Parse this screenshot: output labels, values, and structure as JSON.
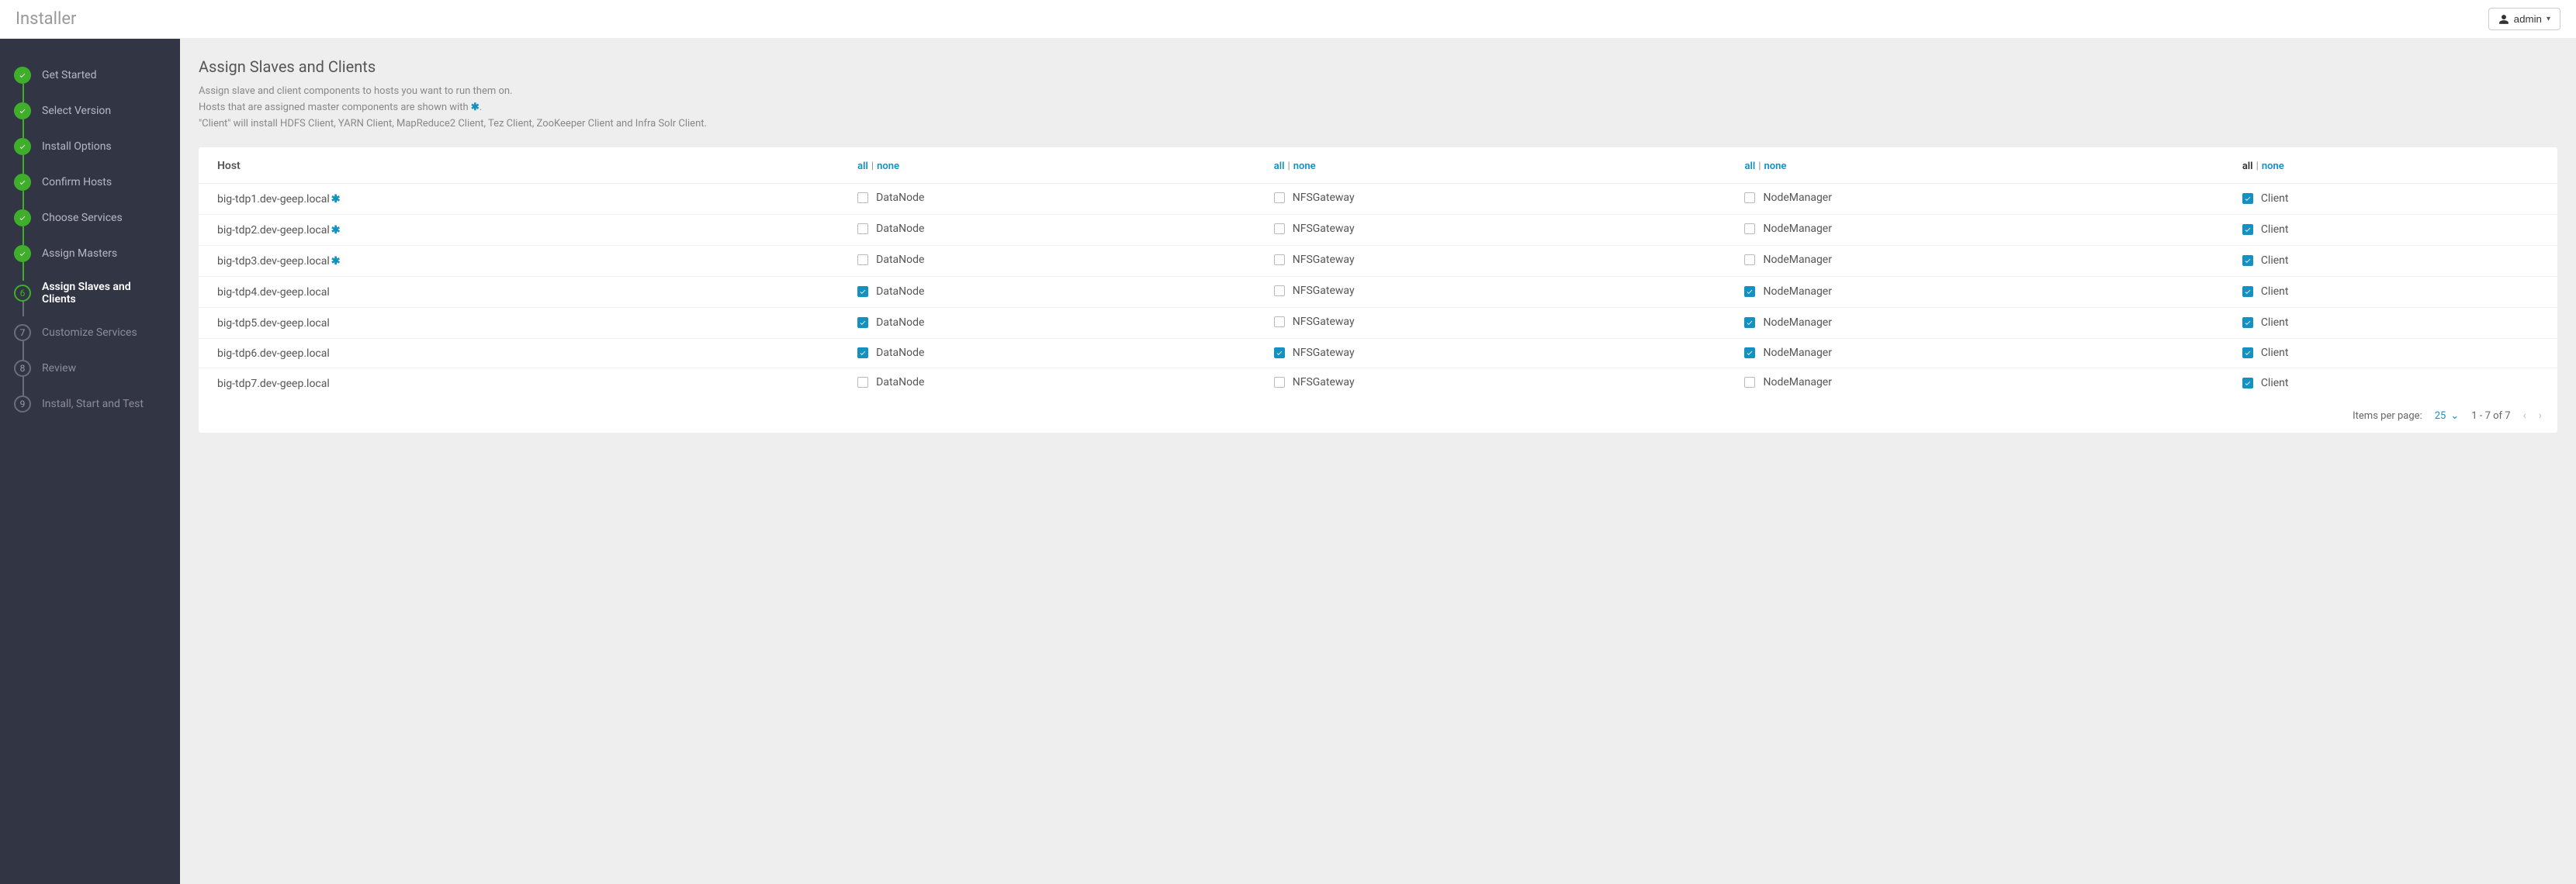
{
  "brand": "Installer",
  "user": {
    "name": "admin"
  },
  "sidebar": {
    "steps": [
      {
        "label": "Get Started",
        "state": "done"
      },
      {
        "label": "Select Version",
        "state": "done"
      },
      {
        "label": "Install Options",
        "state": "done"
      },
      {
        "label": "Confirm Hosts",
        "state": "done"
      },
      {
        "label": "Choose Services",
        "state": "done"
      },
      {
        "label": "Assign Masters",
        "state": "done"
      },
      {
        "label": "Assign Slaves and Clients",
        "state": "current",
        "num": "6"
      },
      {
        "label": "Customize Services",
        "state": "pending",
        "num": "7"
      },
      {
        "label": "Review",
        "state": "pending",
        "num": "8"
      },
      {
        "label": "Install, Start and Test",
        "state": "pending",
        "num": "9"
      }
    ]
  },
  "page": {
    "title": "Assign Slaves and Clients",
    "desc1": "Assign slave and client components to hosts you want to run them on.",
    "desc2a": "Hosts that are assigned master components are shown with ",
    "desc2b": ".",
    "desc3": "\"Client\" will install HDFS Client, YARN Client, MapReduce2 Client, Tez Client, ZooKeeper Client and Infra Solr Client."
  },
  "table": {
    "hostHeader": "Host",
    "allLabel": "all",
    "noneLabel": "none",
    "columns": [
      {
        "key": "datanode",
        "label": "DataNode",
        "header_all_plain": false
      },
      {
        "key": "nfsgateway",
        "label": "NFSGateway",
        "header_all_plain": false
      },
      {
        "key": "nodemanager",
        "label": "NodeManager",
        "header_all_plain": false
      },
      {
        "key": "client",
        "label": "Client",
        "header_all_plain": true
      }
    ],
    "rows": [
      {
        "host": "big-tdp1.dev-geep.local",
        "master": true,
        "datanode": false,
        "nfsgateway": false,
        "nodemanager": false,
        "client": true
      },
      {
        "host": "big-tdp2.dev-geep.local",
        "master": true,
        "datanode": false,
        "nfsgateway": false,
        "nodemanager": false,
        "client": true
      },
      {
        "host": "big-tdp3.dev-geep.local",
        "master": true,
        "datanode": false,
        "nfsgateway": false,
        "nodemanager": false,
        "client": true
      },
      {
        "host": "big-tdp4.dev-geep.local",
        "master": false,
        "datanode": true,
        "nfsgateway": false,
        "nodemanager": true,
        "client": true
      },
      {
        "host": "big-tdp5.dev-geep.local",
        "master": false,
        "datanode": true,
        "nfsgateway": false,
        "nodemanager": true,
        "client": true
      },
      {
        "host": "big-tdp6.dev-geep.local",
        "master": false,
        "datanode": true,
        "nfsgateway": true,
        "nodemanager": true,
        "client": true
      },
      {
        "host": "big-tdp7.dev-geep.local",
        "master": false,
        "datanode": false,
        "nfsgateway": false,
        "nodemanager": false,
        "client": true
      }
    ]
  },
  "pager": {
    "itemsPerPageLabel": "Items per page:",
    "perPage": "25",
    "range": "1 - 7 of 7"
  }
}
